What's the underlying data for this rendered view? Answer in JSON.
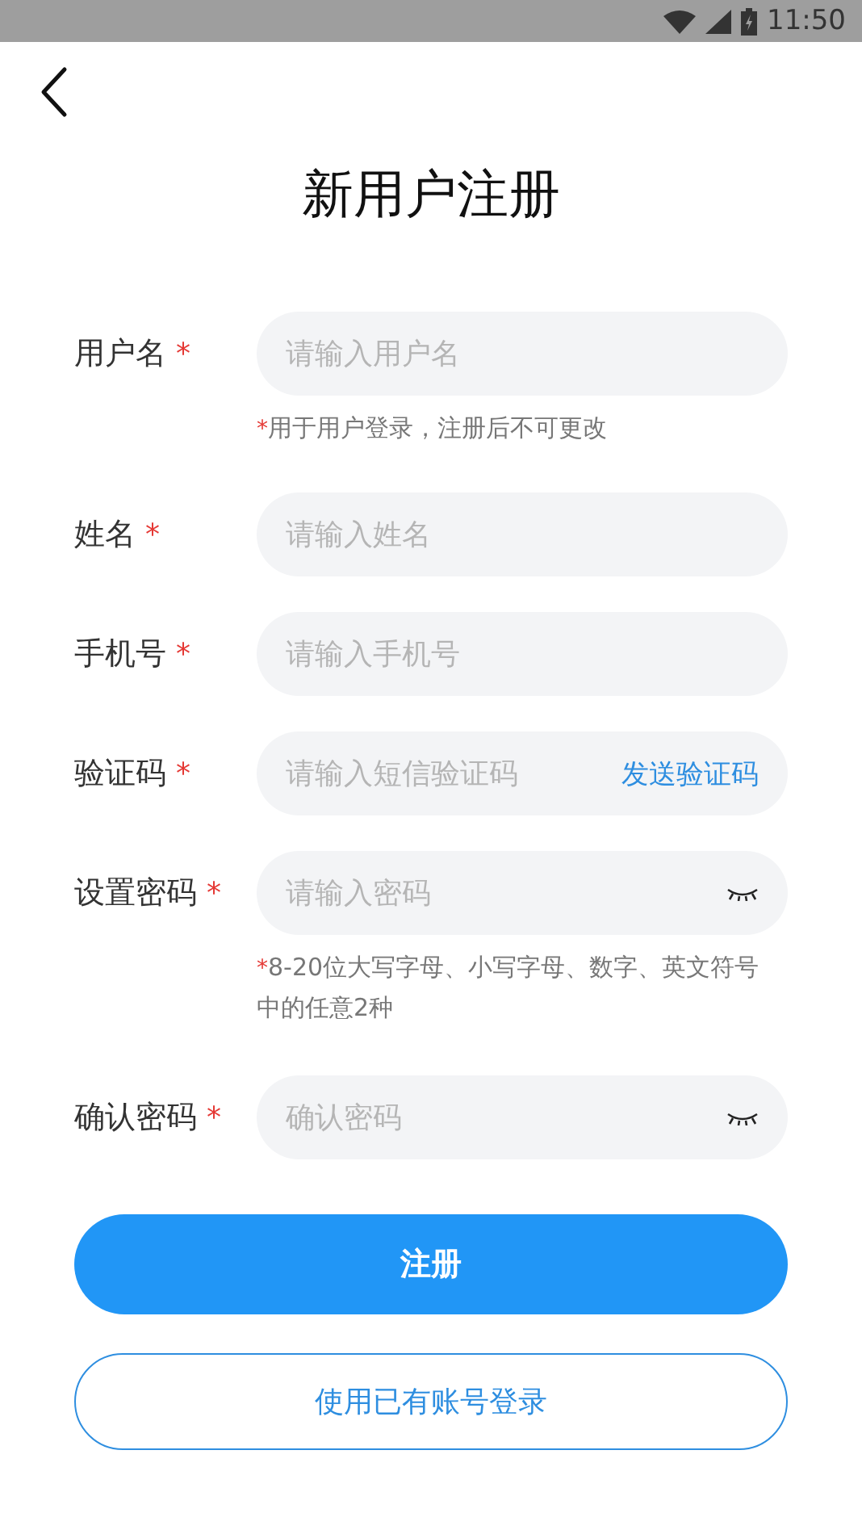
{
  "status_bar": {
    "time": "11:50"
  },
  "title": "新用户注册",
  "fields": [
    {
      "kind": "text",
      "label": "用户名",
      "mark": "*",
      "placeholder": "请输入用户名",
      "hint_mark": "*",
      "hint": "用于用户登录，注册后不可更改"
    },
    {
      "kind": "text",
      "label": "姓名",
      "mark": "*",
      "placeholder": "请输入姓名"
    },
    {
      "kind": "text",
      "label": "手机号",
      "mark": "*",
      "placeholder": "请输入手机号"
    },
    {
      "kind": "code",
      "label": "验证码",
      "mark": "*",
      "placeholder": "请输入短信验证码",
      "action": "发送验证码"
    },
    {
      "kind": "password",
      "label": "设置密码",
      "mark": "*",
      "placeholder": "请输入密码",
      "hint_mark": "*",
      "hint": "8-20位大写字母、小写字母、数字、英文符号中的任意2种"
    },
    {
      "kind": "password",
      "label": "确认密码",
      "mark": "*",
      "placeholder": "确认密码"
    }
  ],
  "primary_button": "注册",
  "secondary_button": "使用已有账号登录"
}
